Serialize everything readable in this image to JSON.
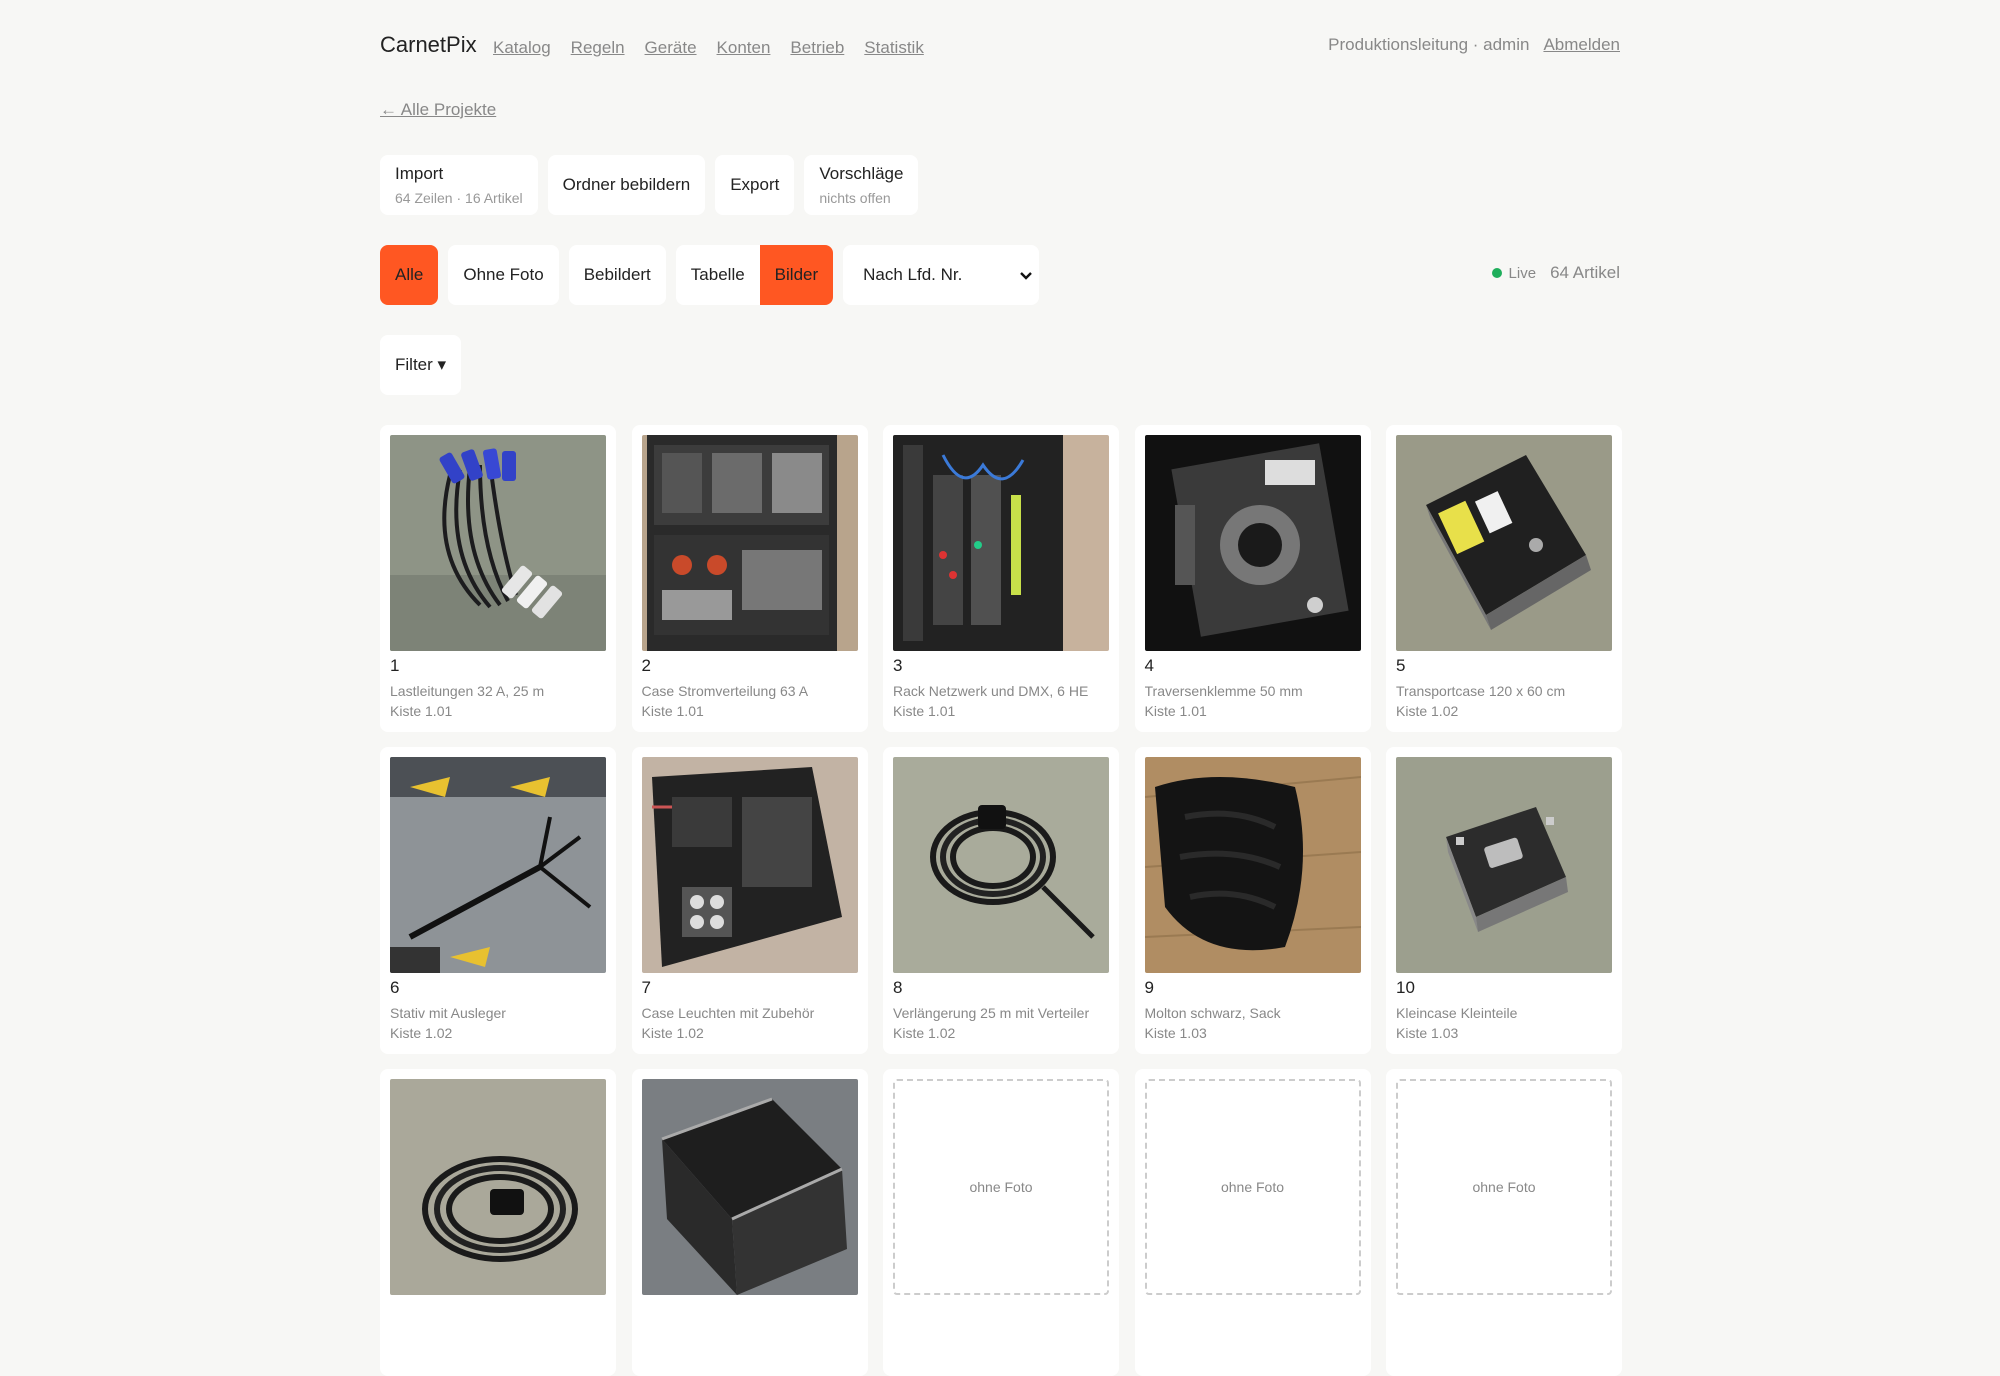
{
  "nav": {
    "brand": "CarnetPix",
    "links": [
      "Katalog",
      "Regeln",
      "Geräte",
      "Konten",
      "Betrieb",
      "Statistik"
    ],
    "user": "Produktionsleitung · admin",
    "logout": "Abmelden"
  },
  "back": "← Alle Projekte",
  "actions": {
    "import": {
      "label": "Import",
      "sub": "64 Zeilen · 16 Artikel"
    },
    "ordner": {
      "label": "Ordner bebildern"
    },
    "export": {
      "label": "Export"
    },
    "vorschlaege": {
      "label": "Vorschläge",
      "sub": "nichts offen"
    }
  },
  "filters": {
    "alle": "Alle",
    "ohne_foto": "Ohne Foto",
    "bebildert": "Bebildert",
    "tabelle": "Tabelle",
    "bilder": "Bilder",
    "sort": "Nach Lfd. Nr.",
    "filter": "Filter ▾"
  },
  "status": {
    "live": "Live",
    "count": "64 Artikel"
  },
  "items": [
    {
      "num": "1",
      "name": "Lastleitungen 32 A, 25 m",
      "box": "Kiste 1.01",
      "photo": "cables-blue"
    },
    {
      "num": "2",
      "name": "Case Stromverteilung 63 A",
      "box": "Kiste 1.01",
      "photo": "power-case"
    },
    {
      "num": "3",
      "name": "Rack Netzwerk und DMX, 6 HE",
      "box": "Kiste 1.01",
      "photo": "network-rack"
    },
    {
      "num": "4",
      "name": "Traversenklemme 50 mm",
      "box": "Kiste 1.01",
      "photo": "truss-clamp"
    },
    {
      "num": "5",
      "name": "Transportcase 120 x 60 cm",
      "box": "Kiste 1.02",
      "photo": "flight-case"
    },
    {
      "num": "6",
      "name": "Stativ mit Ausleger",
      "box": "Kiste 1.02",
      "photo": "stand"
    },
    {
      "num": "7",
      "name": "Case Leuchten mit Zubehör",
      "box": "Kiste 1.02",
      "photo": "light-case"
    },
    {
      "num": "8",
      "name": "Verlängerung 25 m mit Verteiler",
      "box": "Kiste 1.02",
      "photo": "cable-coil"
    },
    {
      "num": "9",
      "name": "Molton schwarz, Sack",
      "box": "Kiste 1.03",
      "photo": "molton-bag"
    },
    {
      "num": "10",
      "name": "Kleincase Kleinteile",
      "box": "Kiste 1.03",
      "photo": "small-case"
    },
    {
      "num": "",
      "name": "",
      "box": "",
      "photo": "cable-coil-2"
    },
    {
      "num": "",
      "name": "",
      "box": "",
      "photo": "large-case"
    },
    {
      "num": "",
      "name": "",
      "box": "",
      "photo": "none",
      "nophoto": "ohne Foto"
    },
    {
      "num": "",
      "name": "",
      "box": "",
      "photo": "none",
      "nophoto": "ohne Foto"
    },
    {
      "num": "",
      "name": "",
      "box": "",
      "photo": "none",
      "nophoto": "ohne Foto"
    }
  ]
}
